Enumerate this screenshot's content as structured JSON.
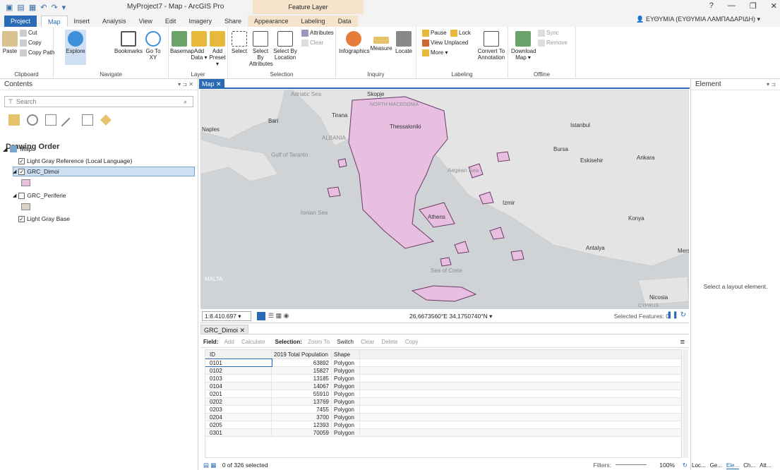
{
  "titlebar": {
    "title": "MyProject7 - Map - ArcGIS Pro",
    "context_tab": "Feature Layer",
    "help": "?",
    "minimize": "—",
    "restore": "❐",
    "close": "✕"
  },
  "tabs": [
    {
      "label": "Project"
    },
    {
      "label": "Map"
    },
    {
      "label": "Insert"
    },
    {
      "label": "Analysis"
    },
    {
      "label": "View"
    },
    {
      "label": "Edit"
    },
    {
      "label": "Imagery"
    },
    {
      "label": "Share"
    },
    {
      "label": "Appearance"
    },
    {
      "label": "Labeling"
    },
    {
      "label": "Data"
    }
  ],
  "user": "ΕΥΘΥΜΙΑ (ΕΥΘΥΜΙΑ ΛΑΜΠΑΔΑΡΙΔΗ) ▾",
  "ribbon": {
    "clipboard": {
      "label": "Clipboard",
      "paste": "Paste",
      "cut": "Cut",
      "copy": "Copy",
      "copy_path": "Copy Path"
    },
    "navigate": {
      "label": "Navigate",
      "explore": "Explore",
      "bookmarks": "Bookmarks",
      "goto": "Go To XY"
    },
    "layer": {
      "label": "Layer",
      "basemap": "Basemap",
      "add_data": "Add Data ▾",
      "add_preset": "Add Preset ▾"
    },
    "selection": {
      "label": "Selection",
      "select": "Select",
      "select_by_attr": "Select By Attributes",
      "select_by_loc": "Select By Location",
      "attributes": "Attributes",
      "clear": "Clear"
    },
    "inquiry": {
      "label": "Inquiry",
      "infographics": "Infographics",
      "measure": "Measure",
      "locate": "Locate"
    },
    "labeling": {
      "label": "Labeling",
      "pause": "Pause",
      "lock": "Lock",
      "view_unplaced": "View Unplaced",
      "more": "More ▾",
      "convert": "Convert To Annotation"
    },
    "offline": {
      "label": "Offline",
      "download": "Download Map ▾",
      "sync": "Sync",
      "remove": "Remove"
    }
  },
  "contents": {
    "title": "Contents",
    "search_placeholder": "Search",
    "drawing_order": "Drawing Order",
    "map": "Map",
    "layers": [
      {
        "name": "Light Gray Reference (Local Language)",
        "checked": true
      },
      {
        "name": "GRC_Dimoi",
        "checked": true
      },
      {
        "name": "GRC_Periferie",
        "checked": false
      },
      {
        "name": "Light Gray Base",
        "checked": true
      }
    ]
  },
  "map": {
    "tab_label": "Map",
    "labels": {
      "adriatic": "Adriatic Sea",
      "skopje": "Skopje",
      "north_macedonia": "NORTH MACEDONIA",
      "tirana": "Tirana",
      "bari": "Bari",
      "naples": "Naples",
      "albania": "ALBANIA",
      "thessaloniki": "Thessaloniki",
      "istanbul": "Istanbul",
      "bursa": "Bursa",
      "eskisehir": "Eskisehir",
      "ankara": "Ankara",
      "gulf_taranto": "Gulf of Taranto",
      "aegean": "Aegean Sea",
      "izmir": "Izmir",
      "ionian": "Ionian Sea",
      "athens": "Athens",
      "konya": "Konya",
      "antalya": "Antalya",
      "mers": "Mers",
      "malta": "MALTA",
      "crete_sea": "Sea of Crete",
      "nicosia": "Nicosia",
      "cyprus": "CYPRUS"
    },
    "scale": "1:8.410.697",
    "coordinates": "26,6673560°E 34,1750740°N",
    "selected_features": "Selected Features: 0"
  },
  "table": {
    "tab_label": "GRC_Dimoi",
    "toolbar": {
      "field": "Field:",
      "add": "Add",
      "calculate": "Calculate",
      "selection": "Selection:",
      "zoom_to": "Zoom To",
      "switch": "Switch",
      "clear": "Clear",
      "delete": "Delete",
      "copy": "Copy"
    },
    "columns": [
      "ID",
      "2019 Total Population",
      "Shape"
    ],
    "rows": [
      [
        "0101",
        "63892",
        "Polygon"
      ],
      [
        "0102",
        "15827",
        "Polygon"
      ],
      [
        "0103",
        "13185",
        "Polygon"
      ],
      [
        "0104",
        "14067",
        "Polygon"
      ],
      [
        "0201",
        "55910",
        "Polygon"
      ],
      [
        "0202",
        "13769",
        "Polygon"
      ],
      [
        "0203",
        "7455",
        "Polygon"
      ],
      [
        "0204",
        "3700",
        "Polygon"
      ],
      [
        "0205",
        "12393",
        "Polygon"
      ],
      [
        "0301",
        "70059",
        "Polygon"
      ]
    ],
    "status": "0 of 326 selected",
    "filters": "Filters:",
    "zoom": "100%"
  },
  "element_pane": {
    "title": "Element",
    "message": "Select a layout element.",
    "tabs": [
      "Loc...",
      "Ge...",
      "Ele...",
      "Ch...",
      "Att..."
    ]
  },
  "colors": {
    "accent": "#2b6bb5",
    "context": "#f6e3cc",
    "polygon_fill": "#e8bfe1",
    "polygon_stroke": "#6b3a66",
    "land": "#e4e4e4",
    "water": "#cfd3d6"
  }
}
